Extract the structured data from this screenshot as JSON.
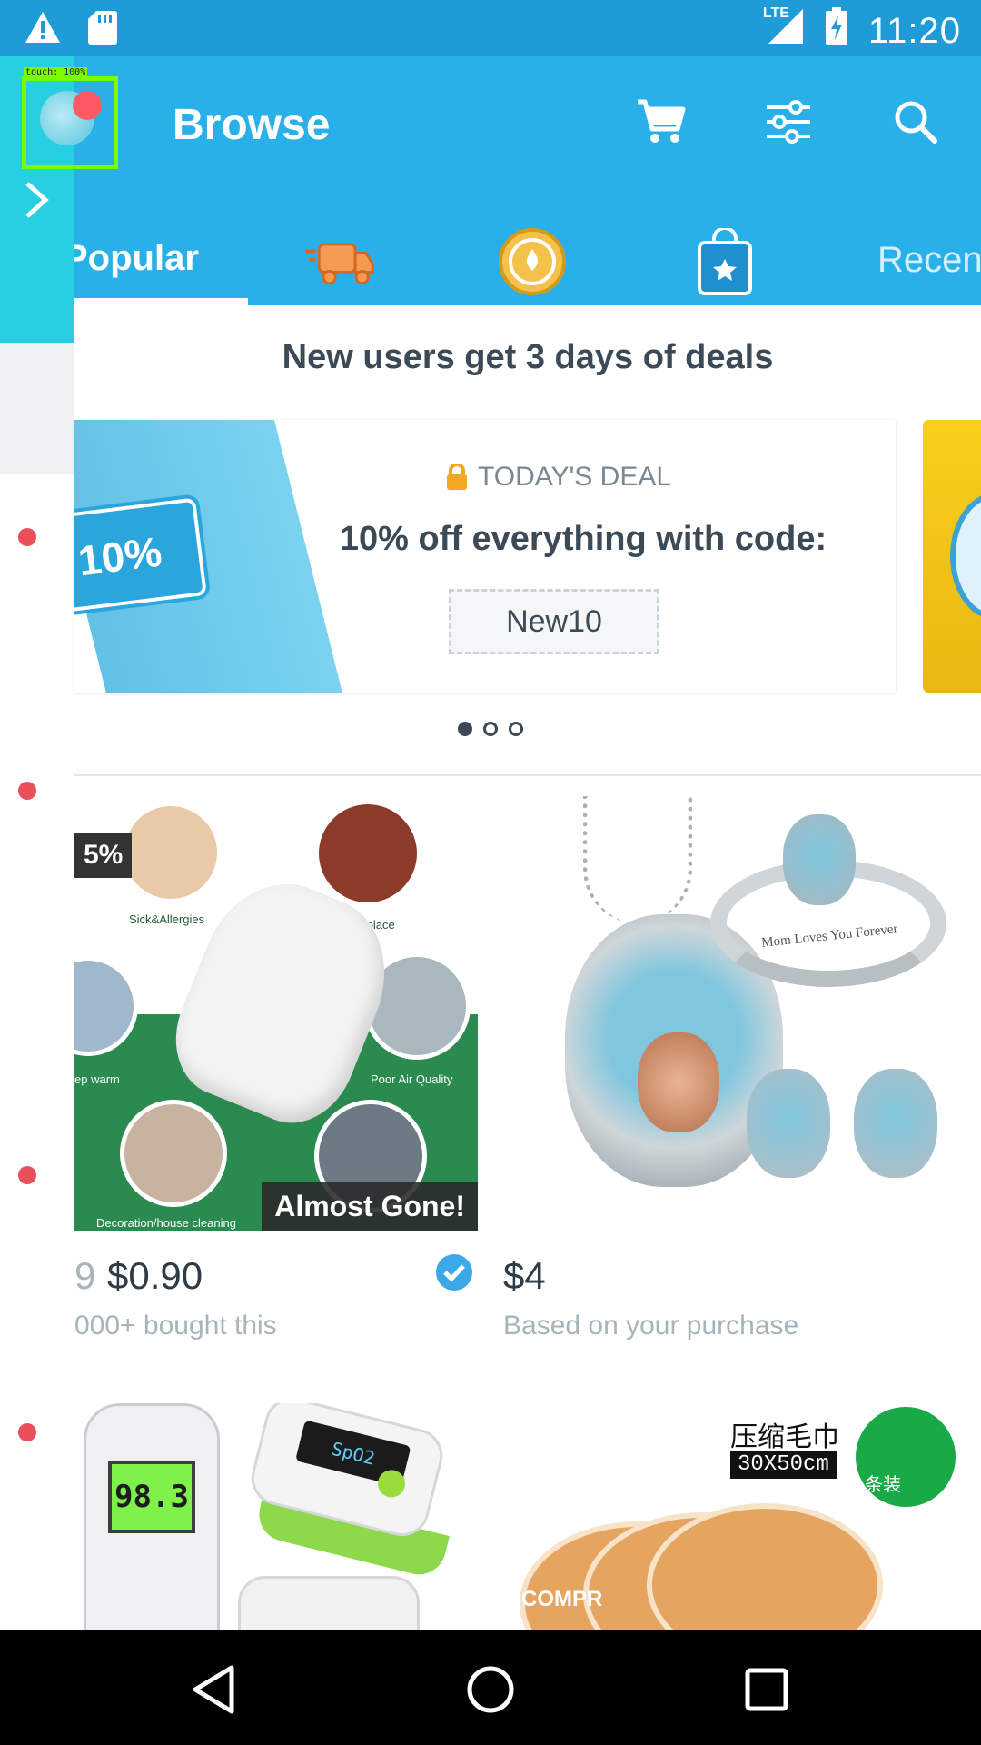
{
  "status_bar": {
    "time": "11:20",
    "network": "LTE",
    "icons": [
      "warning-icon",
      "sd-card-icon",
      "signal-icon",
      "battery-charging-icon"
    ]
  },
  "app_bar": {
    "title": "Browse",
    "actions": [
      "cart-icon",
      "filter-icon",
      "search-icon"
    ]
  },
  "overlay": {
    "touch_label": "touch: 100%"
  },
  "tabs": {
    "popular_label": "Popular",
    "recent_label": "Recen",
    "icons": [
      "fast-shipping-icon",
      "coin-icon",
      "shopping-bag-icon"
    ]
  },
  "promo": {
    "headline": "New users get 3 days of deals",
    "banner": {
      "ticket_text": "10%",
      "deal_label": "TODAY'S DEAL",
      "deal_text": "10% off everything with code:",
      "code": "New10"
    },
    "carousel": {
      "pages": 3,
      "active_index": 0
    }
  },
  "products": [
    {
      "badge": "5%",
      "overlay": "Almost Gone!",
      "image_labels": [
        "Sick&Allergies",
        "Work place",
        "ep warm",
        "Poor Air Quality",
        "Decoration/house cleaning"
      ],
      "old_price_fragment": "9",
      "price": "$0.90",
      "subtitle": "000+ bought this",
      "verified": true
    },
    {
      "image_text": "Mom Loves You Forever",
      "price": "$4",
      "subtitle": "Based on your purchase"
    },
    {
      "image_text": "98.3"
    },
    {
      "image_text_cn": "压缩毛巾",
      "image_size": "30X50cm",
      "badge_cn": "条装",
      "brand_text": "COMPR"
    }
  ],
  "colors": {
    "primary": "#2ab0e9",
    "status_bar": "#1f9bd8",
    "text": "#2f3b45",
    "muted": "#a7b4bc"
  }
}
